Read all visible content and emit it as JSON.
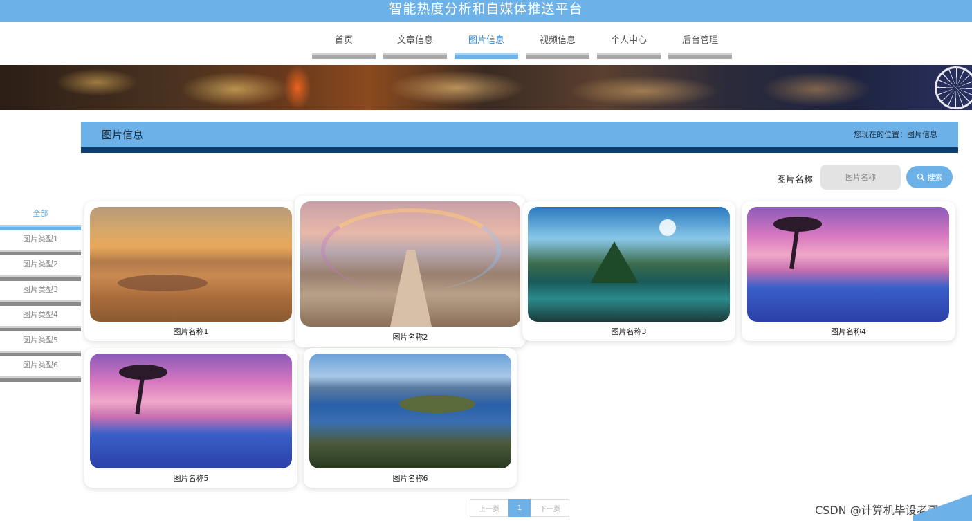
{
  "app": {
    "title": "智能热度分析和自媒体推送平台"
  },
  "nav": {
    "items": [
      {
        "label": "首页",
        "active": false
      },
      {
        "label": "文章信息",
        "active": false
      },
      {
        "label": "图片信息",
        "active": true
      },
      {
        "label": "视频信息",
        "active": false
      },
      {
        "label": "个人中心",
        "active": false
      },
      {
        "label": "后台管理",
        "active": false
      }
    ]
  },
  "section": {
    "title": "图片信息",
    "breadcrumb": "您现在的位置：图片信息"
  },
  "search": {
    "label": "图片名称",
    "placeholder": "图片名称",
    "value": "",
    "button_label": "搜索",
    "button_icon": "search-icon"
  },
  "sidebar": {
    "items": [
      {
        "label": "全部",
        "active": true
      },
      {
        "label": "图片类型1",
        "active": false
      },
      {
        "label": "图片类型2",
        "active": false
      },
      {
        "label": "图片类型3",
        "active": false
      },
      {
        "label": "图片类型4",
        "active": false
      },
      {
        "label": "图片类型5",
        "active": false
      },
      {
        "label": "图片类型6",
        "active": false
      }
    ]
  },
  "cards": [
    {
      "name": "图片名称1",
      "image": "sunset-clouds"
    },
    {
      "name": "图片名称2",
      "image": "rainbow-path"
    },
    {
      "name": "图片名称3",
      "image": "mountain-lake"
    },
    {
      "name": "图片名称4",
      "image": "palm-sunset-pool"
    },
    {
      "name": "图片名称5",
      "image": "palm-sunset-pool"
    },
    {
      "name": "图片名称6",
      "image": "lake-island"
    }
  ],
  "pagination": {
    "prev_label": "上一页",
    "current_page": "1",
    "next_label": "下一页"
  },
  "watermark": "CSDN @计算机毕设老哥",
  "colors": {
    "accent": "#6cb2e8",
    "accent_dark": "#0f3d6e",
    "nav_bar": "#a9a9a9"
  }
}
